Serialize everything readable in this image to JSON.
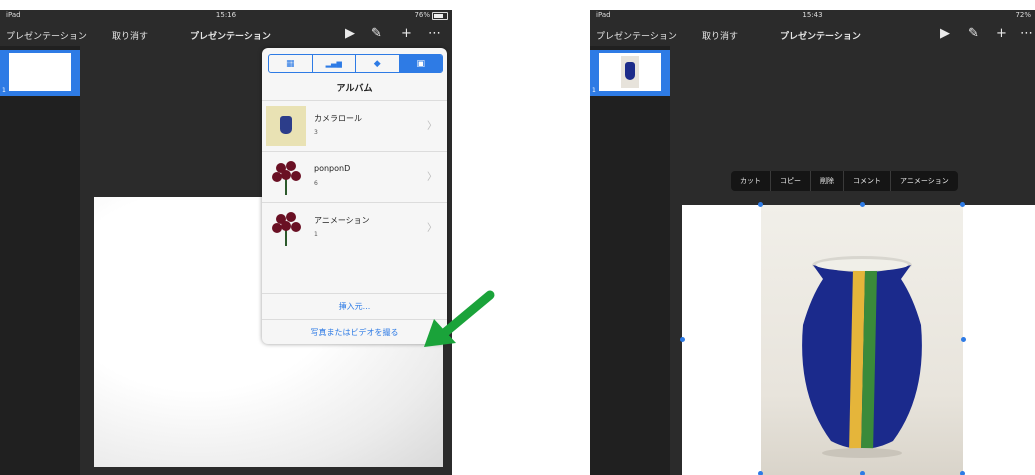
{
  "left_screen": {
    "status": {
      "device": "iPad",
      "time": "15:16",
      "battery": "76%"
    },
    "toolbar": {
      "back_label": "プレゼンテーション",
      "undo_label": "取り消す",
      "title": "プレゼンテーション",
      "icons": [
        "play-icon",
        "brush-icon",
        "plus-icon",
        "more-icon"
      ]
    },
    "slides": [
      {
        "number": "1"
      }
    ],
    "popover": {
      "tabs": [
        {
          "name": "table",
          "glyph": "▦"
        },
        {
          "name": "chart",
          "glyph": "▂▄▆"
        },
        {
          "name": "shape",
          "glyph": "◆"
        },
        {
          "name": "media",
          "glyph": "▣"
        }
      ],
      "title": "アルバム",
      "albums": [
        {
          "name": "カメラロール",
          "count": "3"
        },
        {
          "name": "ponponD",
          "count": "6"
        },
        {
          "name": "アニメーション",
          "count": "1"
        }
      ],
      "insert_from": "挿入元...",
      "take_photo": "写真またはビデオを撮る"
    },
    "arrow_color": "#1aa33a"
  },
  "right_screen": {
    "status": {
      "device": "iPad",
      "time": "15:43",
      "battery": "72%"
    },
    "toolbar": {
      "back_label": "プレゼンテーション",
      "undo_label": "取り消す",
      "title": "プレゼンテーション",
      "icons": [
        "play-icon",
        "brush-icon",
        "plus-icon",
        "more-icon"
      ]
    },
    "slides": [
      {
        "number": "1"
      }
    ],
    "context_menu": [
      "カット",
      "コピー",
      "削除",
      "コメント",
      "アニメーション"
    ]
  },
  "colors": {
    "accent": "#2e7be5",
    "dark_bg": "#2b2b2b"
  }
}
